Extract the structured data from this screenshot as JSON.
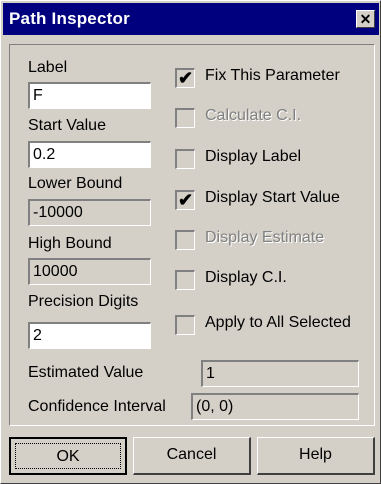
{
  "window": {
    "title": "Path Inspector",
    "close_glyph": "✕"
  },
  "fields": {
    "label": {
      "label": "Label",
      "value": "F"
    },
    "start_value": {
      "label": "Start Value",
      "value": "0.2"
    },
    "lower_bound": {
      "label": "Lower Bound",
      "value": "-10000"
    },
    "high_bound": {
      "label": "High Bound",
      "value": "10000"
    },
    "precision_digits": {
      "label": "Precision Digits",
      "value": "2"
    },
    "estimated_value": {
      "label": "Estimated Value",
      "value": "1"
    },
    "confidence_interval": {
      "label": "Confidence Interval",
      "value": "(0, 0)"
    }
  },
  "checkboxes": [
    {
      "label": "Fix This Parameter",
      "checked": true,
      "enabled": true
    },
    {
      "label": "Calculate C.I.",
      "checked": false,
      "enabled": false
    },
    {
      "label": "Display Label",
      "checked": false,
      "enabled": true
    },
    {
      "label": "Display Start Value",
      "checked": true,
      "enabled": true
    },
    {
      "label": "Display Estimate",
      "checked": false,
      "enabled": false
    },
    {
      "label": "Display C.I.",
      "checked": false,
      "enabled": true
    },
    {
      "label": "Apply to All Selected",
      "checked": false,
      "enabled": true
    }
  ],
  "check_glyph": "✔",
  "buttons": {
    "ok": "OK",
    "cancel": "Cancel",
    "help": "Help"
  }
}
